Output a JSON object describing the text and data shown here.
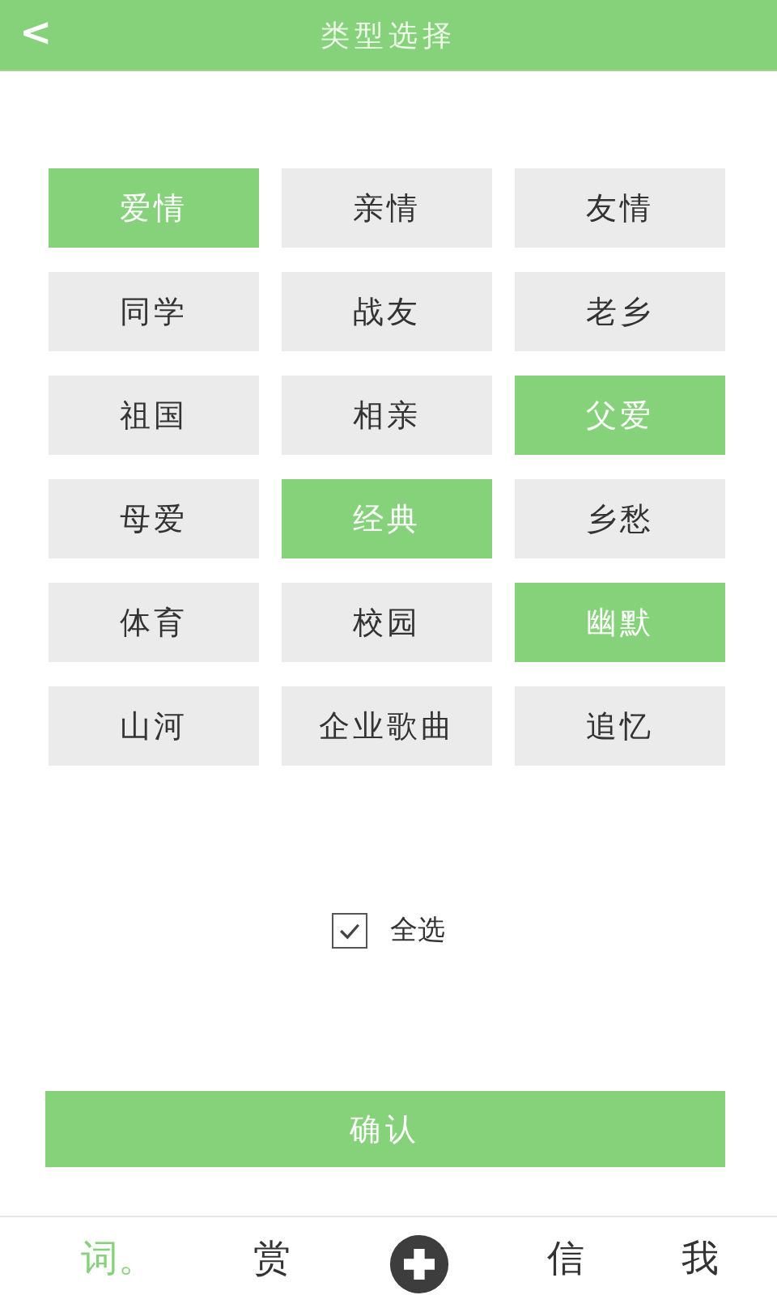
{
  "header": {
    "back": "<",
    "title": "类型选择"
  },
  "categories": [
    {
      "label": "爱情",
      "selected": true
    },
    {
      "label": "亲情",
      "selected": false
    },
    {
      "label": "友情",
      "selected": false
    },
    {
      "label": "同学",
      "selected": false
    },
    {
      "label": "战友",
      "selected": false
    },
    {
      "label": "老乡",
      "selected": false
    },
    {
      "label": "祖国",
      "selected": false
    },
    {
      "label": "相亲",
      "selected": false
    },
    {
      "label": "父爱",
      "selected": true
    },
    {
      "label": "母爱",
      "selected": false
    },
    {
      "label": "经典",
      "selected": true
    },
    {
      "label": "乡愁",
      "selected": false
    },
    {
      "label": "体育",
      "selected": false
    },
    {
      "label": "校园",
      "selected": false
    },
    {
      "label": "幽默",
      "selected": true
    },
    {
      "label": "山河",
      "selected": false
    },
    {
      "label": "企业歌曲",
      "selected": false
    },
    {
      "label": "追忆",
      "selected": false
    }
  ],
  "select_all": {
    "label": "全选",
    "checked": true
  },
  "confirm": "确认",
  "nav": [
    {
      "kind": "text",
      "label": "词。",
      "selected": true
    },
    {
      "kind": "text",
      "label": "赏",
      "selected": false
    },
    {
      "kind": "add",
      "selected": false
    },
    {
      "kind": "text",
      "label": "信",
      "selected": false
    },
    {
      "kind": "text",
      "label": "我",
      "selected": false
    }
  ]
}
